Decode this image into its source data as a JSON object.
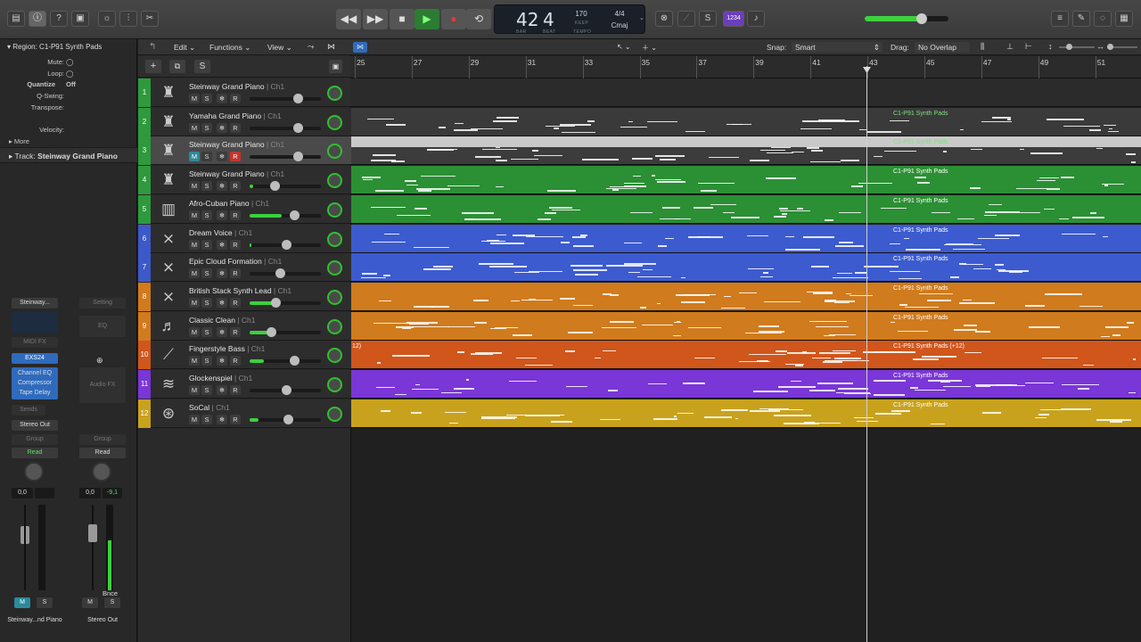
{
  "toolbar": {
    "left_icons": [
      "library-icon",
      "inspector-icon",
      "help-icon",
      "editors-icon",
      "smart-controls-icon",
      "mixer-icon",
      "scissors-icon"
    ],
    "transport": {
      "rewind": "◀◀",
      "forward": "▶▶",
      "stop": "■",
      "play": "▶",
      "record": "●",
      "cycle": "⟲"
    },
    "lcd": {
      "bar": "42",
      "beat": "4",
      "bar_label": "BAR",
      "beat_label": "BEAT",
      "tempo": "170",
      "tempo_mode": "KEEP",
      "tempo_label": "TEMPO",
      "time_sig": "4/4",
      "key": "Cmaj"
    },
    "count_in": "1234",
    "right_icons": [
      "list-editors-icon",
      "note-pad-icon",
      "loop-browser-icon",
      "browser-icon"
    ]
  },
  "inspector": {
    "region_title": "Region: C1-P91 Synth Pads",
    "mute_label": "Mute:",
    "loop_label": "Loop:",
    "quantize_label": "Quantize",
    "quantize_value": "Off",
    "qswing_label": "Q-Swing:",
    "transpose_label": "Transpose:",
    "velocity_label": "Velocity:",
    "more_label": "More",
    "track_label": "Track:",
    "track_value": "Steinway Grand Piano",
    "strip1": {
      "setting": "Steinway...",
      "midi_fx": "MIDI FX",
      "instrument": "EXS24",
      "fx": [
        "Channel EQ",
        "Compressor",
        "Tape Delay"
      ],
      "sends": "Sends",
      "output": "Stereo Out",
      "group": "Group",
      "auto": "Read",
      "pan_value": "0,0",
      "peak": "",
      "mute": "M",
      "solo": "S",
      "name": "Steinway...nd Piano"
    },
    "strip2": {
      "setting": "Setting",
      "eq": "EQ",
      "audio_fx": "Audio FX",
      "group": "Group",
      "auto": "Read",
      "pan_value": "0,0",
      "peak": "-9,1",
      "bounce": "Bnce",
      "mute": "M",
      "solo": "S",
      "name": "Stereo Out"
    }
  },
  "track_header": {
    "add": "+",
    "dup": "⧉",
    "s": "S",
    "menus": {
      "edit": "Edit",
      "functions": "Functions",
      "view": "View"
    },
    "snap_label": "Snap:",
    "snap_value": "Smart",
    "drag_label": "Drag:",
    "drag_value": "No Overlap"
  },
  "ruler": [
    "25",
    "27",
    "29",
    "31",
    "33",
    "35",
    "37",
    "39",
    "41",
    "43",
    "45",
    "47",
    "49",
    "51"
  ],
  "tracks": [
    {
      "num": "1",
      "name": "Steinway Grand Piano",
      "ch": "Ch1",
      "color": "#2e9a3c",
      "icon": "grand-piano-icon",
      "lane": "#2b2b2b",
      "region": "",
      "lvl": 0,
      "pos": 0.68
    },
    {
      "num": "2",
      "name": "Yamaha Grand Piano",
      "ch": "Ch1",
      "color": "#2e9a3c",
      "icon": "grand-piano-icon",
      "lane": "#3a3a3a",
      "region": "C1-P91 Synth Pads",
      "lvl": 0,
      "pos": 0.68
    },
    {
      "num": "3",
      "name": "Steinway Grand Piano",
      "ch": "Ch1",
      "color": "#2e9a3c",
      "icon": "grand-piano-icon",
      "lane": "#3c3c3c",
      "region": "C1-P91 Synth Pads",
      "lvl": 0,
      "pos": 0.68
    },
    {
      "num": "4",
      "name": "Steinway Grand Piano",
      "ch": "Ch1",
      "color": "#2e9a3c",
      "icon": "grand-piano-icon",
      "lane": "#2b8f34",
      "region": "C1-P91 Synth Pads",
      "lvl": 0.05,
      "pos": 0.35
    },
    {
      "num": "5",
      "name": "Afro-Cuban Piano",
      "ch": "Ch1",
      "color": "#2e9a3c",
      "icon": "upright-piano-icon",
      "lane": "#2b8f34",
      "region": "C1-P91 Synth Pads",
      "lvl": 0.45,
      "pos": 0.63
    },
    {
      "num": "6",
      "name": "Dream Voice",
      "ch": "Ch1",
      "color": "#3c59c9",
      "icon": "keyboard-stand-icon",
      "lane": "#3c5bcf",
      "region": "C1-P91 Synth Pads",
      "lvl": 0.02,
      "pos": 0.51
    },
    {
      "num": "7",
      "name": "Epic Cloud Formation",
      "ch": "Ch1",
      "color": "#3c59c9",
      "icon": "keyboard-stand-icon",
      "lane": "#3c5bcf",
      "region": "C1-P91 Synth Pads",
      "lvl": 0,
      "pos": 0.43
    },
    {
      "num": "8",
      "name": "British Stack Synth Lead",
      "ch": "Ch1",
      "color": "#d27a1e",
      "icon": "keyboard-stand-icon",
      "lane": "#d07b1d",
      "region": "C1-P91 Synth Pads",
      "lvl": 0.4,
      "pos": 0.36
    },
    {
      "num": "9",
      "name": "Classic Clean",
      "ch": "Ch1",
      "color": "#d27a1e",
      "icon": "electric-guitar-icon",
      "lane": "#d07b1d",
      "region": "C1-P91 Synth Pads",
      "lvl": 0.3,
      "pos": 0.3
    },
    {
      "num": "10",
      "name": "Fingerstyle Bass",
      "ch": "Ch1",
      "color": "#d0561c",
      "icon": "bass-guitar-icon",
      "lane": "#d0561c",
      "region": "C1-P91 Synth Pads (+12)",
      "region_left": "12)",
      "lvl": 0.2,
      "pos": 0.63
    },
    {
      "num": "11",
      "name": "Glockenspiel",
      "ch": "Ch1",
      "color": "#7a36d6",
      "icon": "glockenspiel-icon",
      "lane": "#7a36d6",
      "region": "C1-P91 Synth Pads",
      "lvl": 0,
      "pos": 0.51
    },
    {
      "num": "12",
      "name": "SoCal",
      "ch": "Ch1",
      "color": "#c9a21d",
      "icon": "drum-kit-icon",
      "lane": "#c9a21d",
      "region": "C1-P91 Synth Pads",
      "lvl": 0.12,
      "pos": 0.54
    }
  ]
}
